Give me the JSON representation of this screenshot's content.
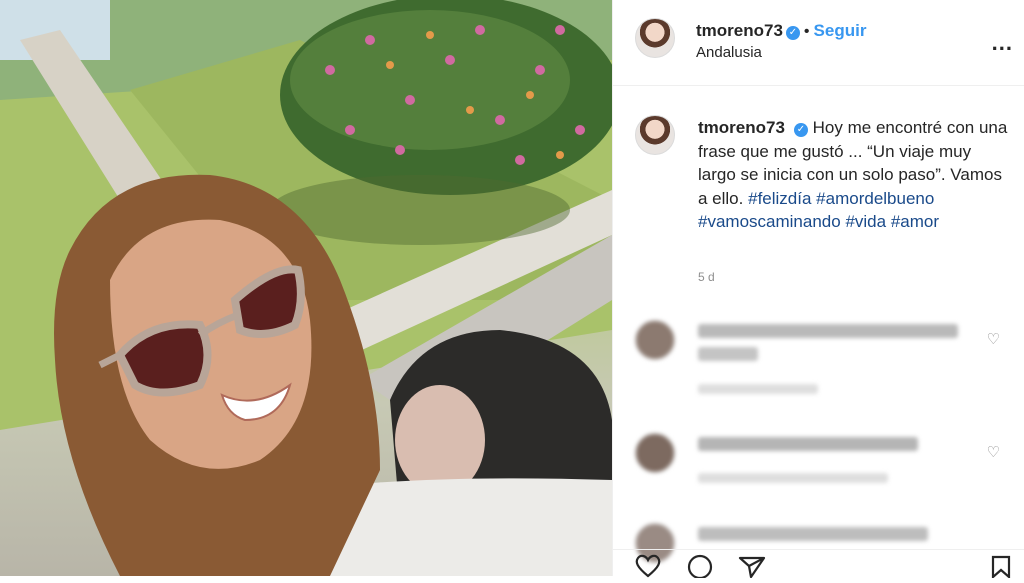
{
  "post": {
    "username": "tmoreno73",
    "follow_label": "Seguir",
    "separator": "•",
    "location": "Andalusia",
    "more_label": "...",
    "caption_text": "Hoy me encontré con una frase que me gustó ... “Un viaje muy largo se inicia con un solo paso”. Vamos a ello.",
    "hashtags": [
      "#felizdía",
      "#amordelbueno",
      "#vamoscaminando",
      "#vida",
      "#amor"
    ],
    "time_ago": "5 d"
  },
  "icons": {
    "verified": "verified-badge-icon",
    "like": "heart-icon",
    "comment": "comment-icon",
    "share": "share-icon",
    "save": "bookmark-icon"
  },
  "colors": {
    "accent": "#3897f0",
    "text": "#262626",
    "muted": "#8e8e8e"
  }
}
